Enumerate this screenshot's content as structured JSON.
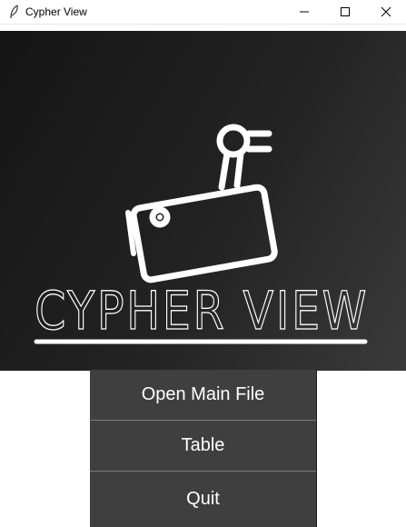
{
  "window": {
    "title": "Cypher View",
    "controls": [
      "minimize-icon",
      "maximize-icon",
      "close-icon"
    ]
  },
  "banner": {
    "logo_icon": "security-camera-icon",
    "logo_text": "CYPHER VIEW"
  },
  "menu": {
    "buttons": [
      {
        "label": "Open Main File"
      },
      {
        "label": "Table"
      },
      {
        "label": "Quit"
      }
    ]
  },
  "colors": {
    "banner_bg": "#1c1c1c",
    "button_bg": "#3f3f3f",
    "text": "#ffffff"
  }
}
